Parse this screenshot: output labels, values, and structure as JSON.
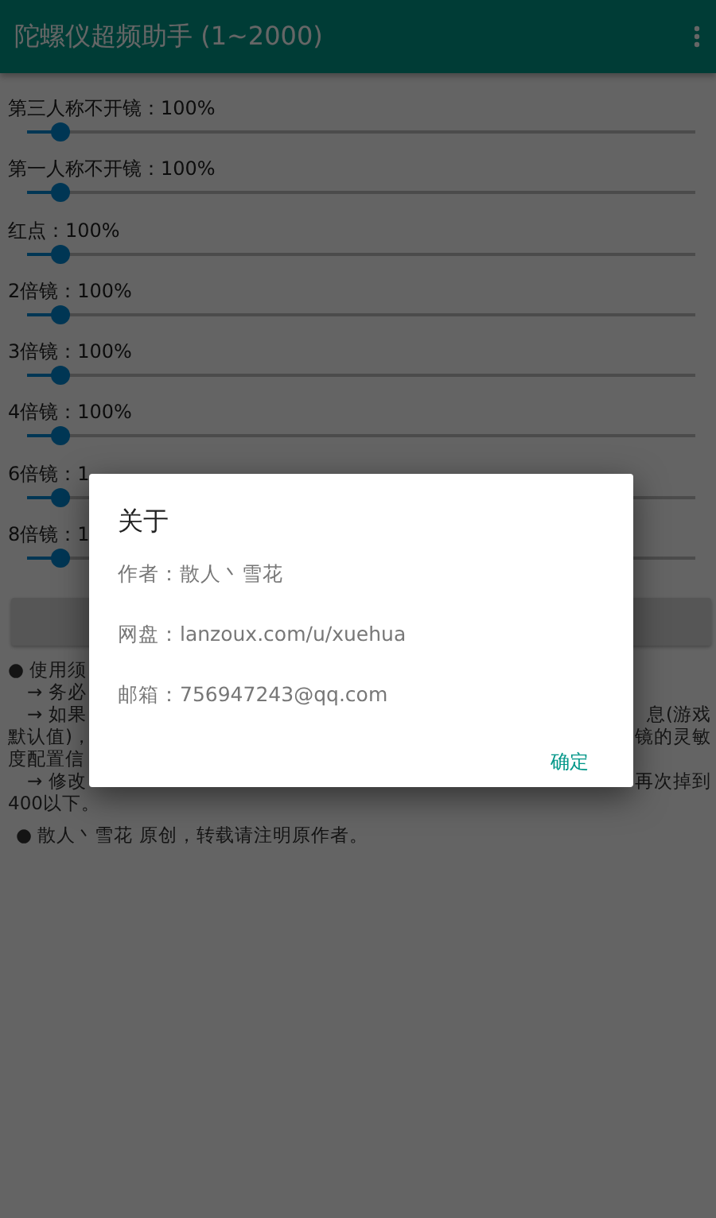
{
  "app_bar": {
    "title": "陀螺仪超频助手 (1~2000)"
  },
  "sliders": [
    {
      "label": "第三人称不开镜：100%",
      "level": 0.05
    },
    {
      "label": "第一人称不开镜：100%",
      "level": 0.05
    },
    {
      "label": "红点：100%",
      "level": 0.05
    },
    {
      "label": "2倍镜：100%",
      "level": 0.05
    },
    {
      "label": "3倍镜：100%",
      "level": 0.05
    },
    {
      "label": "4倍镜：100%",
      "level": 0.05
    },
    {
      "label": "6倍镜：1",
      "level": 0.05
    },
    {
      "label": "8倍镜：1",
      "level": 0.05
    }
  ],
  "notes": [
    {
      "left": "● 使用须"
    },
    {
      "left": "　→ 务必"
    },
    {
      "left": "　→ 如果",
      "right": "息(游戏"
    },
    {
      "left": "默认值)，",
      "right": "镜的灵敏"
    },
    {
      "left": "度配置信"
    },
    {
      "left": "　→ 修改",
      "right": "再次掉到"
    },
    {
      "left": "400以下。"
    }
  ],
  "footer_note": "● 散人丶雪花 原创，转载请注明原作者。",
  "dialog": {
    "title": "关于",
    "lines": [
      "作者：散人丶雪花",
      "网盘：lanzoux.com/u/xuehua",
      "邮箱：756947243@qq.com"
    ],
    "button": "确定"
  }
}
